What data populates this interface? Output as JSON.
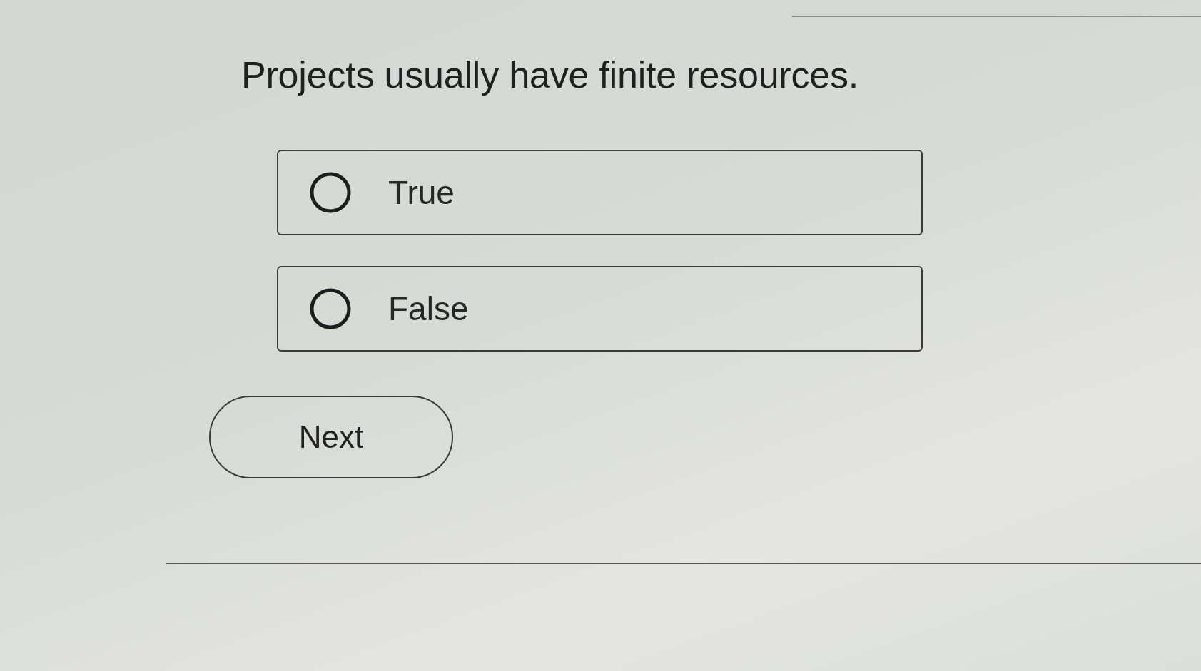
{
  "question": "Projects usually have finite resources.",
  "options": [
    {
      "label": "True",
      "selected": false
    },
    {
      "label": "False",
      "selected": false
    }
  ],
  "next_button": {
    "label": "Next"
  }
}
